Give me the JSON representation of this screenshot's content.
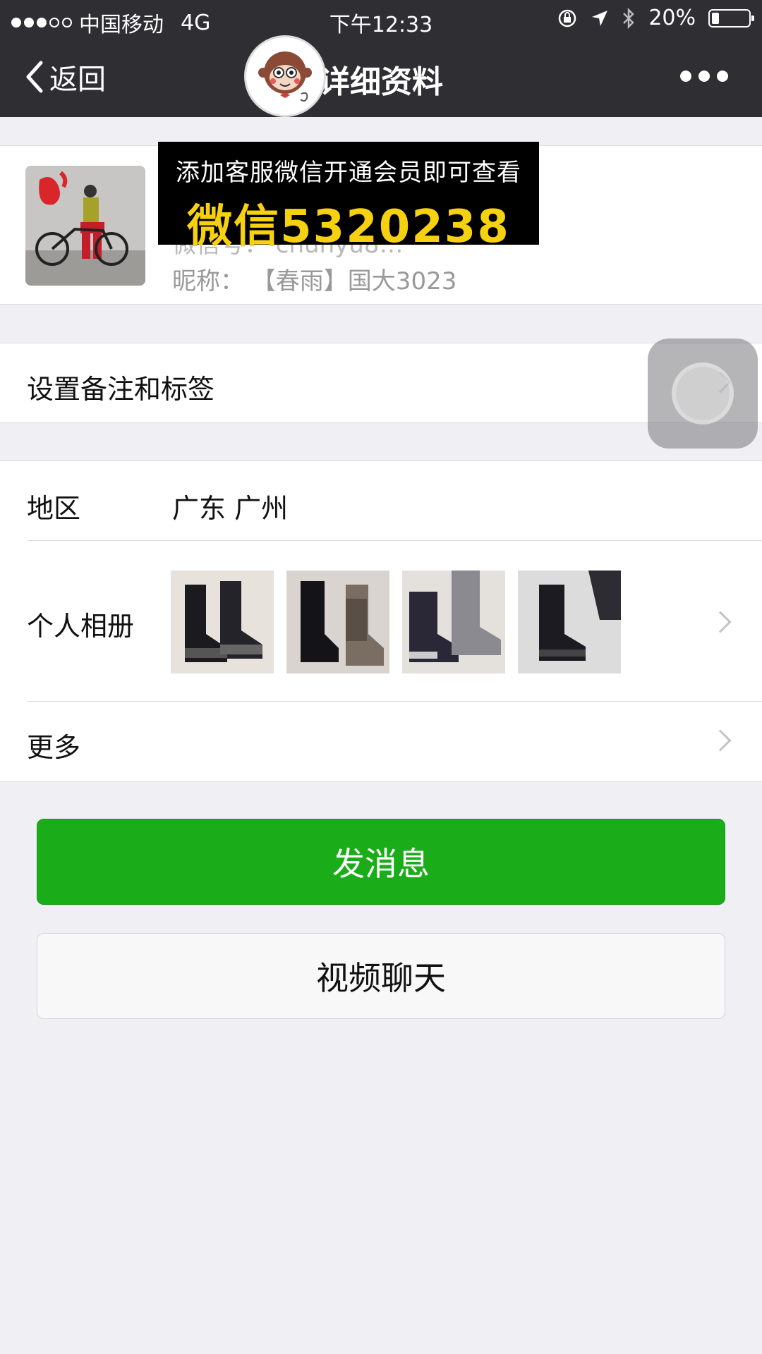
{
  "status_bar": {
    "carrier": "中国移动",
    "network": "4G",
    "time": "下午12:33",
    "battery": "20%",
    "battery_level": 0.2
  },
  "nav": {
    "back_label": "返回",
    "title": "详细资料"
  },
  "profile": {
    "wechat_id_partial": "微信号：  chunyu8…",
    "nickname": "昵称：  【春雨】国大3023"
  },
  "ad_banner": {
    "line1": "添加客服微信开通会员即可查看",
    "line2": "微信5320238"
  },
  "remark_row": {
    "label": "设置备注和标签"
  },
  "region_row": {
    "label": "地区",
    "value": "广东 广州"
  },
  "album_row": {
    "label": "个人相册",
    "thumbnails": [
      "boots-photo-1",
      "boots-photo-2",
      "boots-photo-3",
      "boots-photo-4"
    ]
  },
  "more_row": {
    "label": "更多"
  },
  "buttons": {
    "send_message": "发消息",
    "video_chat": "视频聊天"
  },
  "colors": {
    "nav_bg": "#2f2f33",
    "primary_green": "#1aad19",
    "banner_yellow": "#f5d10f"
  }
}
